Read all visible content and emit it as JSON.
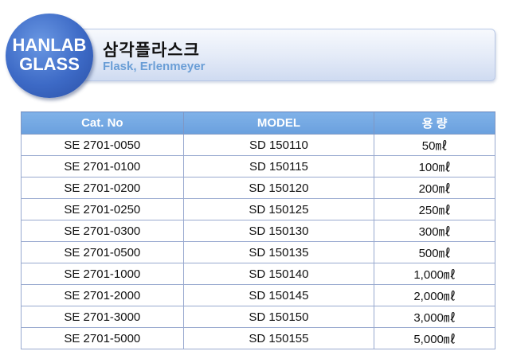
{
  "header": {
    "logo_line1": "HANLAB",
    "logo_line2": "GLASS",
    "title": "삼각플라스크",
    "subtitle": "Flask,  Erlenmeyer"
  },
  "table": {
    "columns": [
      "Cat. No",
      "MODEL",
      "용  량"
    ],
    "rows": [
      {
        "cat": "SE 2701-0050",
        "model": "SD 150110",
        "capacity": "50㎖"
      },
      {
        "cat": "SE 2701-0100",
        "model": "SD 150115",
        "capacity": "100㎖"
      },
      {
        "cat": "SE 2701-0200",
        "model": "SD 150120",
        "capacity": "200㎖"
      },
      {
        "cat": "SE 2701-0250",
        "model": "SD 150125",
        "capacity": "250㎖"
      },
      {
        "cat": "SE 2701-0300",
        "model": "SD 150130",
        "capacity": "300㎖"
      },
      {
        "cat": "SE 2701-0500",
        "model": "SD 150135",
        "capacity": "500㎖"
      },
      {
        "cat": "SE 2701-1000",
        "model": "SD 150140",
        "capacity": "1,000㎖"
      },
      {
        "cat": "SE 2701-2000",
        "model": "SD 150145",
        "capacity": "2,000㎖"
      },
      {
        "cat": "SE 2701-3000",
        "model": "SD 150150",
        "capacity": "3,000㎖"
      },
      {
        "cat": "SE 2701-5000",
        "model": "SD 150155",
        "capacity": "5,000㎖"
      }
    ]
  },
  "colors": {
    "header_bg": "#6aa0de",
    "badge": "#3d6ac6",
    "subtitle": "#6a9ed6"
  }
}
